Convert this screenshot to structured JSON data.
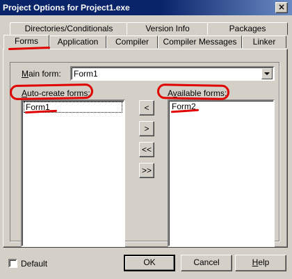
{
  "window": {
    "title": "Project Options for Project1.exe",
    "close_glyph": "×"
  },
  "tabs_row1": [
    {
      "label": "Directories/Conditionals"
    },
    {
      "label": "Version Info"
    },
    {
      "label": "Packages"
    }
  ],
  "tabs_row2": [
    {
      "label": "Forms",
      "active": true
    },
    {
      "label": "Application"
    },
    {
      "label": "Compiler"
    },
    {
      "label": "Compiler Messages"
    },
    {
      "label": "Linker"
    }
  ],
  "main_form": {
    "label_prefix": "M",
    "label_rest": "ain form:",
    "value": "Form1"
  },
  "auto_create": {
    "label_prefix": "A",
    "label_rest": "uto-create forms:",
    "items": [
      "Form1"
    ]
  },
  "available": {
    "label_pre": "A",
    "label_u": "v",
    "label_rest": "ailable forms:",
    "items": [
      "Form2"
    ]
  },
  "transfer_buttons": [
    "<",
    ">",
    "<<",
    ">>"
  ],
  "footer": {
    "default_label": "Default",
    "default_checked": false,
    "ok_label": "OK",
    "cancel_label": "Cancel",
    "help_prefix": "H",
    "help_rest": "elp"
  },
  "annotation_color": "#e00000"
}
